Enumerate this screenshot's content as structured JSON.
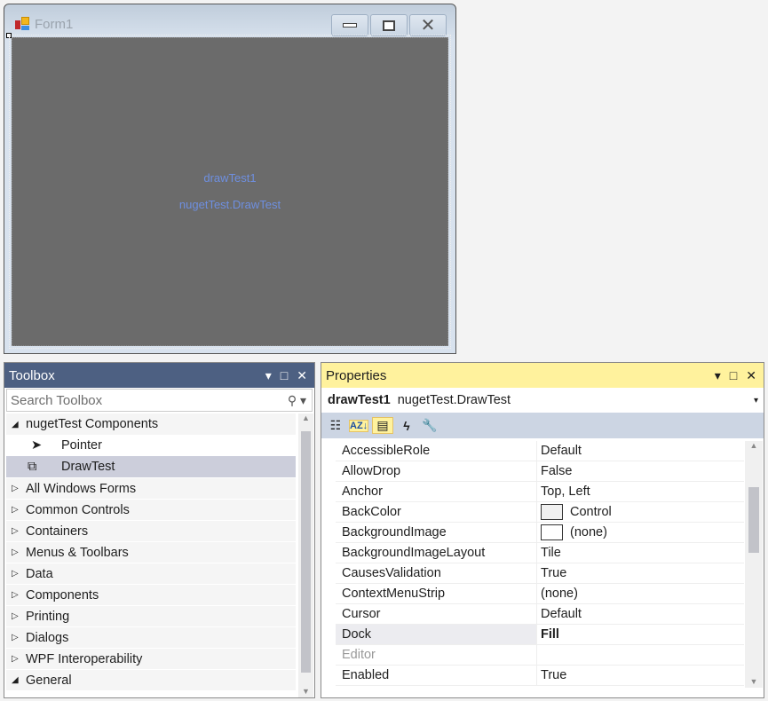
{
  "form": {
    "title": "Form1",
    "control_name": "drawTest1",
    "control_type": "nugetTest.DrawTest",
    "back_color": "#6b6b6b"
  },
  "toolbox": {
    "title": "Toolbox",
    "search_placeholder": "Search Toolbox",
    "group": "nugetTest Components",
    "items": [
      {
        "label": "Pointer",
        "icon": "pointer-icon"
      },
      {
        "label": "DrawTest",
        "icon": "component-icon",
        "selected": true
      }
    ],
    "categories": [
      "All Windows Forms",
      "Common Controls",
      "Containers",
      "Menus & Toolbars",
      "Data",
      "Components",
      "Printing",
      "Dialogs",
      "WPF Interoperability",
      "General"
    ]
  },
  "properties": {
    "title": "Properties",
    "object_name": "drawTest1",
    "object_type": "nugetTest.DrawTest",
    "rows": [
      {
        "name": "AccessibleRole",
        "value": "Default"
      },
      {
        "name": "AllowDrop",
        "value": "False"
      },
      {
        "name": "Anchor",
        "value": "Top, Left"
      },
      {
        "name": "BackColor",
        "value": "Control",
        "swatch": "#f0f0f0"
      },
      {
        "name": "BackgroundImage",
        "value": "(none)",
        "swatch": "#ffffff"
      },
      {
        "name": "BackgroundImageLayout",
        "value": "Tile"
      },
      {
        "name": "CausesValidation",
        "value": "True"
      },
      {
        "name": "ContextMenuStrip",
        "value": "(none)"
      },
      {
        "name": "Cursor",
        "value": "Default"
      },
      {
        "name": "Dock",
        "value": "Fill",
        "bold": true,
        "selected": true
      },
      {
        "name": "Editor",
        "value": "",
        "disabled": true
      },
      {
        "name": "Enabled",
        "value": "True"
      }
    ]
  },
  "colors": {
    "toolbox_header": "#4d6082",
    "properties_header": "#fff29d",
    "selection": "#cccedb"
  }
}
